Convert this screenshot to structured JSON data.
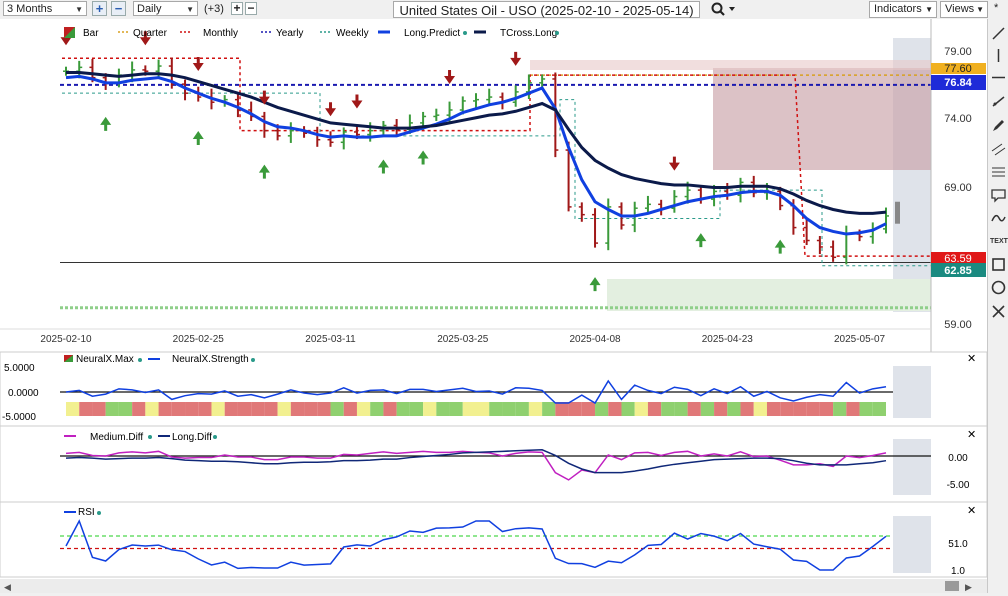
{
  "toolbar": {
    "period": "3 Months",
    "interval": "Daily",
    "indicator_count": "(+3)",
    "title": "United States Oil - USO (2025-02-10 - 2025-05-14)",
    "indicators_label": "Indicators",
    "views_label": "Views",
    "star": "*"
  },
  "legend": {
    "bar": "Bar",
    "quarter": "Quarter",
    "monthly": "Monthly",
    "yearly": "Yearly",
    "weekly": "Weekly",
    "long_predict": "Long.Predict",
    "tcross_long": "TCross.Long"
  },
  "price_axis": {
    "ticks": [
      "79.00",
      "74.00",
      "69.00",
      "59.00"
    ],
    "badges": {
      "quarter": "77.60",
      "yearly": "76.84",
      "monthly": "63.59",
      "weekly": "62.85"
    }
  },
  "date_axis": [
    "2025-02-10",
    "2025-02-25",
    "2025-03-11",
    "2025-03-25",
    "2025-04-08",
    "2025-04-23",
    "2025-05-07"
  ],
  "panel1": {
    "legend_max": "NeuralX.Max",
    "legend_strength": "NeuralX.Strength",
    "ticks": [
      "5.0000",
      "0.0000",
      "-5.0000"
    ]
  },
  "panel2": {
    "legend_medium": "Medium.Diff",
    "legend_long": "Long.Diff",
    "ticks": [
      "0.00",
      "-5.00"
    ]
  },
  "panel3": {
    "legend_rsi": "RSI",
    "ticks": [
      "51.0",
      "1.0"
    ]
  },
  "colors": {
    "up": "#3a9a3a",
    "down": "#a01818",
    "long_predict": "#1040e0",
    "tcross": "#0b1a4a",
    "monthly": "#d01010",
    "yearly": "#1a1ab0",
    "weekly": "#2a9a8a",
    "quarter": "#d8a020"
  },
  "chart_data": {
    "type": "line",
    "title": "United States Oil - USO (2025-02-10 - 2025-05-14)",
    "dates": [
      "2025-02-10",
      "2025-02-11",
      "2025-02-12",
      "2025-02-13",
      "2025-02-14",
      "2025-02-18",
      "2025-02-19",
      "2025-02-20",
      "2025-02-21",
      "2025-02-24",
      "2025-02-25",
      "2025-02-26",
      "2025-02-27",
      "2025-02-28",
      "2025-03-03",
      "2025-03-04",
      "2025-03-05",
      "2025-03-06",
      "2025-03-07",
      "2025-03-10",
      "2025-03-11",
      "2025-03-12",
      "2025-03-13",
      "2025-03-14",
      "2025-03-17",
      "2025-03-18",
      "2025-03-19",
      "2025-03-20",
      "2025-03-21",
      "2025-03-24",
      "2025-03-25",
      "2025-03-26",
      "2025-03-27",
      "2025-03-28",
      "2025-03-31",
      "2025-04-01",
      "2025-04-02",
      "2025-04-03",
      "2025-04-04",
      "2025-04-07",
      "2025-04-08",
      "2025-04-09",
      "2025-04-10",
      "2025-04-11",
      "2025-04-14",
      "2025-04-15",
      "2025-04-16",
      "2025-04-17",
      "2025-04-21",
      "2025-04-22",
      "2025-04-23",
      "2025-04-24",
      "2025-04-25",
      "2025-04-28",
      "2025-04-29",
      "2025-04-30",
      "2025-05-01",
      "2025-05-02",
      "2025-05-05",
      "2025-05-06",
      "2025-05-07",
      "2025-05-08",
      "2025-05-09"
    ],
    "close": [
      77.9,
      78.2,
      77.4,
      77.0,
      77.6,
      78.0,
      77.9,
      78.3,
      76.9,
      76.2,
      75.9,
      75.5,
      75.7,
      74.9,
      74.4,
      73.3,
      72.9,
      73.3,
      73.1,
      72.6,
      72.4,
      73.2,
      73.0,
      73.3,
      73.7,
      73.4,
      73.9,
      74.4,
      74.5,
      74.9,
      75.6,
      75.7,
      75.9,
      75.5,
      76.3,
      77.0,
      77.3,
      71.8,
      67.4,
      66.8,
      64.6,
      67.4,
      66.0,
      67.3,
      67.6,
      67.3,
      68.2,
      68.7,
      68.0,
      68.6,
      68.3,
      69.3,
      68.5,
      68.6,
      67.5,
      65.8,
      64.8,
      64.3,
      63.5,
      65.3,
      65.1,
      65.7,
      66.7
    ],
    "series": [
      {
        "name": "Long.Predict",
        "values": [
          77.4,
          77.5,
          77.3,
          77.0,
          77.0,
          77.2,
          77.3,
          77.4,
          77.1,
          76.6,
          76.2,
          75.8,
          75.5,
          75.1,
          74.6,
          74.0,
          73.6,
          73.5,
          73.3,
          73.0,
          72.8,
          72.9,
          72.8,
          72.8,
          72.9,
          72.9,
          73.2,
          73.5,
          73.8,
          74.2,
          74.7,
          75.0,
          75.3,
          75.5,
          75.8,
          76.2,
          76.6,
          75.0,
          72.0,
          69.5,
          67.8,
          67.2,
          66.7,
          66.7,
          66.9,
          67.2,
          67.5,
          67.8,
          68.0,
          68.2,
          68.3,
          68.5,
          68.6,
          68.6,
          68.3,
          67.5,
          66.5,
          65.8,
          65.5,
          65.3,
          65.4,
          65.6,
          66.1
        ]
      },
      {
        "name": "TCross.Long",
        "values": [
          77.8,
          77.8,
          77.7,
          77.6,
          77.5,
          77.6,
          77.7,
          77.7,
          77.6,
          77.4,
          77.1,
          76.8,
          76.5,
          76.2,
          75.9,
          75.5,
          75.1,
          74.8,
          74.5,
          74.2,
          73.9,
          73.8,
          73.7,
          73.6,
          73.5,
          73.5,
          73.5,
          73.6,
          73.7,
          73.9,
          74.1,
          74.3,
          74.5,
          74.6,
          74.8,
          75.1,
          75.4,
          74.9,
          73.4,
          72.0,
          71.0,
          70.4,
          69.9,
          69.6,
          69.4,
          69.2,
          69.1,
          69.1,
          69.0,
          68.9,
          68.9,
          69.0,
          69.0,
          69.0,
          68.8,
          68.4,
          67.9,
          67.5,
          67.2,
          67.0,
          66.9,
          66.9,
          67.0
        ]
      }
    ],
    "levels": {
      "Quarter": 77.6,
      "Yearly": 76.84,
      "Monthly": 63.59,
      "Weekly": 62.85
    },
    "ylim": [
      59,
      80
    ],
    "ylabel": "",
    "xlabel": ""
  }
}
